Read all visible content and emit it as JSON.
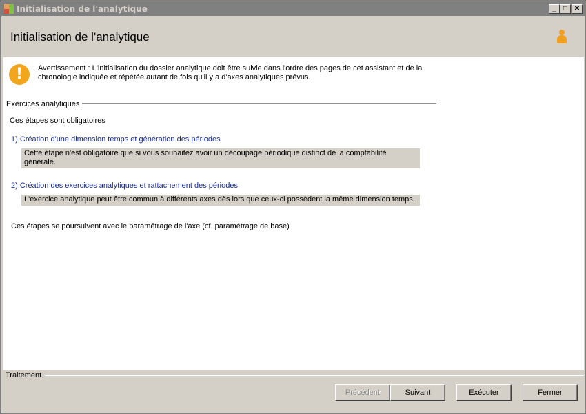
{
  "window": {
    "title": "Initialisation de l'analytique",
    "controls": {
      "minimize": "_",
      "maximize": "□",
      "close": "✕"
    }
  },
  "header": {
    "title": "Initialisation de l'analytique",
    "icon": "user-icon"
  },
  "warning": {
    "icon": "warning-icon",
    "symbol": "!",
    "text": "Avertissement : L'initialisation du dossier analytique doit être suivie dans l'ordre des pages de cet assistant et de la chronologie indiquée et répétée autant de fois qu'il y a d'axes analytiques prévus."
  },
  "section": {
    "label": "Exercices analytiques",
    "intro": "Ces étapes sont obligatoires",
    "steps": [
      {
        "title": "1) Création d'une dimension temps et génération des périodes",
        "description": "Cette étape n'est obligatoire que si vous souhaitez avoir un découpage périodique distinct de la comptabilité générale."
      },
      {
        "title": "2) Création des exercices analytiques et rattachement des périodes",
        "description": "L'exercice analytique peut être commun à différents axes dès lors que ceux-ci possèdent la même dimension temps."
      }
    ],
    "outro": "Ces étapes se poursuivent avec le paramétrage de l'axe (cf. paramétrage de base)"
  },
  "footer": {
    "label": "Traitement",
    "buttons": {
      "previous": "Précédent",
      "next": "Suivant",
      "execute": "Exécuter",
      "close": "Fermer"
    }
  },
  "colors": {
    "link_blue": "#1a2d8c",
    "warning_orange": "#f2a61e",
    "titlebar_gray": "#808080",
    "panel_gray": "#d4d0c8"
  }
}
